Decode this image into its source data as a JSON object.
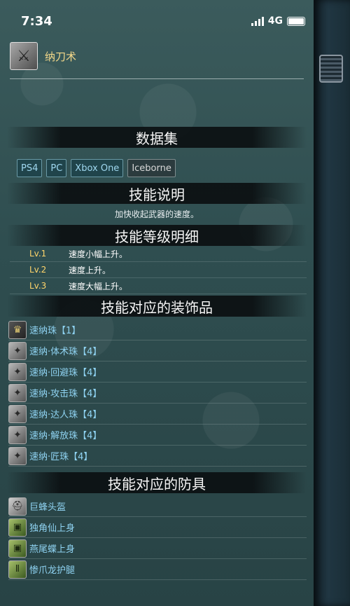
{
  "status": {
    "time": "7:34",
    "network": "4G"
  },
  "skill": {
    "name": "纳刀术"
  },
  "sections": {
    "dataset": "数据集",
    "skill_desc": "技能说明",
    "level_detail": "技能等级明细",
    "decorations": "技能对应的装饰品",
    "armor": "技能对应的防具"
  },
  "platforms": [
    "PS4",
    "PC",
    "Xbox One",
    "Iceborne"
  ],
  "description": "加快收起武器的速度。",
  "levels": [
    {
      "lv": "Lv.1",
      "text": "速度小幅上升。"
    },
    {
      "lv": "Lv.2",
      "text": "速度上升。"
    },
    {
      "lv": "Lv.3",
      "text": "速度大幅上升。"
    }
  ],
  "decorations": [
    {
      "name": "速纳珠【1】",
      "icon": "trophy-icon"
    },
    {
      "name": "速纳·体术珠【4】",
      "icon": "gem-icon"
    },
    {
      "name": "速纳·回避珠【4】",
      "icon": "gem-icon"
    },
    {
      "name": "速纳·攻击珠【4】",
      "icon": "gem-icon"
    },
    {
      "name": "速纳·达人珠【4】",
      "icon": "gem-icon"
    },
    {
      "name": "速纳·解放珠【4】",
      "icon": "gem-icon"
    },
    {
      "name": "速纳·匠珠【4】",
      "icon": "gem-icon"
    }
  ],
  "armor": [
    {
      "name": "巨蜂头盔",
      "icon": "helmet-icon"
    },
    {
      "name": "独角仙上身",
      "icon": "chest-icon"
    },
    {
      "name": "燕尾蝶上身",
      "icon": "chest-icon"
    },
    {
      "name": "惨爪龙护腿",
      "icon": "legs-icon"
    }
  ]
}
